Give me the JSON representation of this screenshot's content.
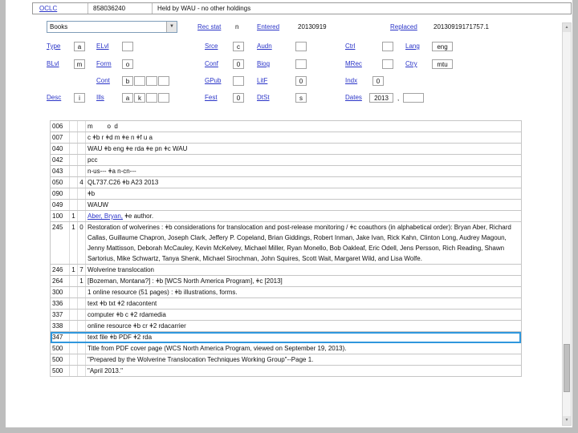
{
  "colors": {
    "link": "#2b35c8",
    "highlight": "#2f97dd"
  },
  "header": {
    "oclc": "OCLC",
    "record_number": "858036240",
    "holdings": "Held by WAU - no other holdings"
  },
  "fixed": {
    "format": "Books",
    "rec_stat": {
      "label": "Rec stat",
      "value": "n"
    },
    "entered": {
      "label": "Entered",
      "value": "20130919"
    },
    "replaced": {
      "label": "Replaced",
      "value": "20130919171757.1"
    },
    "type": {
      "label": "Type",
      "value": "a"
    },
    "elvl": {
      "label": "ELvl",
      "value": ""
    },
    "srce": {
      "label": "Srce",
      "value": "c"
    },
    "audn": {
      "label": "Audn",
      "value": ""
    },
    "ctrl": {
      "label": "Ctrl",
      "value": ""
    },
    "lang": {
      "label": "Lang",
      "value": "eng"
    },
    "blvl": {
      "label": "BLvl",
      "value": "m"
    },
    "form": {
      "label": "Form",
      "value": "o"
    },
    "conf": {
      "label": "Conf",
      "value": "0"
    },
    "biog": {
      "label": "Biog",
      "value": ""
    },
    "mrec": {
      "label": "MRec",
      "value": ""
    },
    "ctry": {
      "label": "Ctry",
      "value": "mtu"
    },
    "cont": {
      "label": "Cont",
      "boxes": [
        "b",
        "",
        "",
        ""
      ]
    },
    "gpub": {
      "label": "GPub",
      "value": ""
    },
    "litf": {
      "label": "LitF",
      "value": "0"
    },
    "indx": {
      "label": "Indx",
      "value": "0"
    },
    "desc": {
      "label": "Desc",
      "value": "i"
    },
    "ills": {
      "label": "Ills",
      "boxes": [
        "a",
        "k",
        "",
        ""
      ]
    },
    "fest": {
      "label": "Fest",
      "value": "0"
    },
    "dtst": {
      "label": "DtSt",
      "value": "s"
    },
    "dates": {
      "label": "Dates",
      "value1": "2013",
      "separator": ",",
      "value2": ""
    }
  },
  "fields": [
    {
      "tag": "006",
      "i1": "",
      "i2": "",
      "content": "m        o  d"
    },
    {
      "tag": "007",
      "i1": "",
      "i2": "",
      "content": "c ǂb r ǂd m ǂe n ǂf u a"
    },
    {
      "tag": "040",
      "i1": "",
      "i2": "",
      "content": "WAU ǂb eng ǂe rda ǂe pn ǂc WAU"
    },
    {
      "tag": "042",
      "i1": "",
      "i2": "",
      "content": "pcc"
    },
    {
      "tag": "043",
      "i1": "",
      "i2": "",
      "content": "n-us--- ǂa n-cn---"
    },
    {
      "tag": "050",
      "i1": "",
      "i2": "4",
      "content": "QL737.C26 ǂb A23 2013"
    },
    {
      "tag": "090",
      "i1": "",
      "i2": "",
      "content": "ǂb"
    },
    {
      "tag": "049",
      "i1": "",
      "i2": "",
      "content": "WAUW"
    },
    {
      "tag": "100",
      "i1": "1",
      "i2": "",
      "link": "Aber, Bryan,",
      "content": " ǂe author."
    },
    {
      "tag": "245",
      "i1": "1",
      "i2": "0",
      "content": "Restoration of wolverines : ǂb considerations for translocation and post-release monitoring / ǂc coauthors (in alphabetical order): Bryan Aber, Richard Callas, Guillaume Chapron, Joseph Clark, Jeffery P. Copeland, Brian Giddings, Robert Inman, Jake Ivan, Rick Kahn, Clinton Long, Audrey Magoun, Jenny Mattisson, Deborah McCauley, Kevin McKelvey, Michael Miller, Ryan Monello, Bob Oakleaf, Eric Odell, Jens Persson, Rich Reading, Shawn Sartorius, Mike Schwartz, Tanya Shenk, Michael Sirochman, John Squires, Scott Wait, Margaret Wild, and Lisa Wolfe."
    },
    {
      "tag": "246",
      "i1": "1",
      "i2": "7",
      "content": "Wolverine translocation"
    },
    {
      "tag": "264",
      "i1": "",
      "i2": "1",
      "content": "[Bozeman, Montana?] : ǂb [WCS North America Program], ǂc [2013]"
    },
    {
      "tag": "300",
      "i1": "",
      "i2": "",
      "content": "1 online resource (51 pages) : ǂb illustrations, forms."
    },
    {
      "tag": "336",
      "i1": "",
      "i2": "",
      "content": "text ǂb txt ǂ2 rdacontent"
    },
    {
      "tag": "337",
      "i1": "",
      "i2": "",
      "content": "computer ǂb c ǂ2 rdamedia"
    },
    {
      "tag": "338",
      "i1": "",
      "i2": "",
      "content": "online resource ǂb cr ǂ2 rdacarrier"
    },
    {
      "tag": "347",
      "i1": "",
      "i2": "",
      "content": "text file ǂb PDF ǂ2 rda",
      "highlighted": true
    },
    {
      "tag": "500",
      "i1": "",
      "i2": "",
      "content": "Title from PDF cover page (WCS North America Program, viewed on September 19, 2013)."
    },
    {
      "tag": "500",
      "i1": "",
      "i2": "",
      "content": "\"Prepared by the Wolverine Translocation Techniques Working Group\"--Page 1."
    },
    {
      "tag": "500",
      "i1": "",
      "i2": "",
      "content": "\"April 2013.\""
    }
  ],
  "icons": {
    "dropdown_arrow": "▼",
    "scroll_up": "▲",
    "scroll_down": "▼"
  }
}
